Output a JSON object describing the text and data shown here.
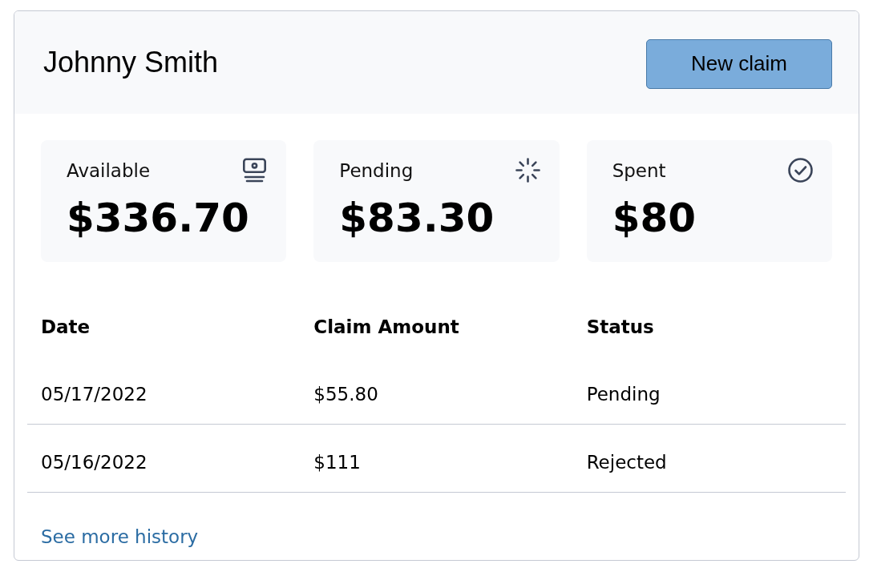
{
  "header": {
    "title": "Johnny Smith",
    "button": "New claim"
  },
  "stats": [
    {
      "label": "Available",
      "value": "$336.70"
    },
    {
      "label": "Pending",
      "value": "$83.30"
    },
    {
      "label": "Spent",
      "value": "$80"
    }
  ],
  "table": {
    "columns": [
      "Date",
      "Claim Amount",
      "Status"
    ],
    "rows": [
      [
        "05/17/2022",
        "$55.80",
        "Pending"
      ],
      [
        "05/16/2022",
        "$111",
        "Rejected"
      ]
    ]
  },
  "link": "See more history"
}
